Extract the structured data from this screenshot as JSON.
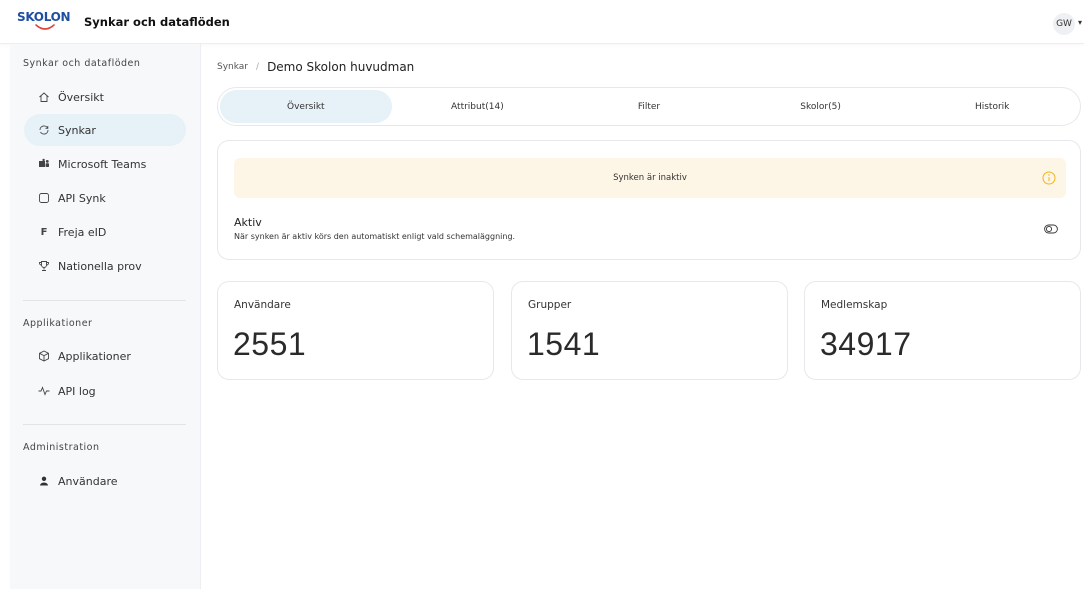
{
  "header": {
    "logo_text": "SKOLON",
    "app_title": "Synkar och dataflöden",
    "user_initials": "GW",
    "user_menu_icon": "chevron-down-icon"
  },
  "sidebar": {
    "sections": [
      {
        "title": "Synkar och dataflöden",
        "items": [
          {
            "label": "Översikt",
            "icon": "home-icon"
          },
          {
            "label": "Synkar",
            "icon": "sync-icon",
            "active": true
          },
          {
            "label": "Microsoft Teams",
            "icon": "teams-icon"
          },
          {
            "label": "API Synk",
            "icon": "square-icon"
          },
          {
            "label": "Freja eID",
            "icon": "freja-icon"
          },
          {
            "label": "Nationella prov",
            "icon": "trophy-icon"
          }
        ]
      },
      {
        "title": "Applikationer",
        "items": [
          {
            "label": "Applikationer",
            "icon": "box-icon"
          },
          {
            "label": "API log",
            "icon": "activity-icon"
          }
        ]
      },
      {
        "title": "Administration",
        "items": [
          {
            "label": "Användare",
            "icon": "user-icon"
          }
        ]
      }
    ]
  },
  "breadcrumb": {
    "parent": "Synkar",
    "separator": "/",
    "current": "Demo Skolon huvudman"
  },
  "tabs": [
    {
      "label": "Översikt",
      "active": true
    },
    {
      "label": "Attribut(14)"
    },
    {
      "label": "Filter"
    },
    {
      "label": "Skolor(5)"
    },
    {
      "label": "Historik"
    }
  ],
  "status": {
    "warning_text": "Synken är inaktiv",
    "active_title": "Aktiv",
    "active_description": "När synken är aktiv körs den automatiskt enligt vald schemaläggning."
  },
  "stats": [
    {
      "label": "Användare",
      "value": "2551"
    },
    {
      "label": "Grupper",
      "value": "1541"
    },
    {
      "label": "Medlemskap",
      "value": "34917"
    }
  ],
  "colors": {
    "accent_active": "#e6f1f8",
    "warning_bg": "#fdf6e6",
    "warning_icon": "#f2b418",
    "logo_blue": "#1f4fa3",
    "logo_red": "#e0443a"
  }
}
